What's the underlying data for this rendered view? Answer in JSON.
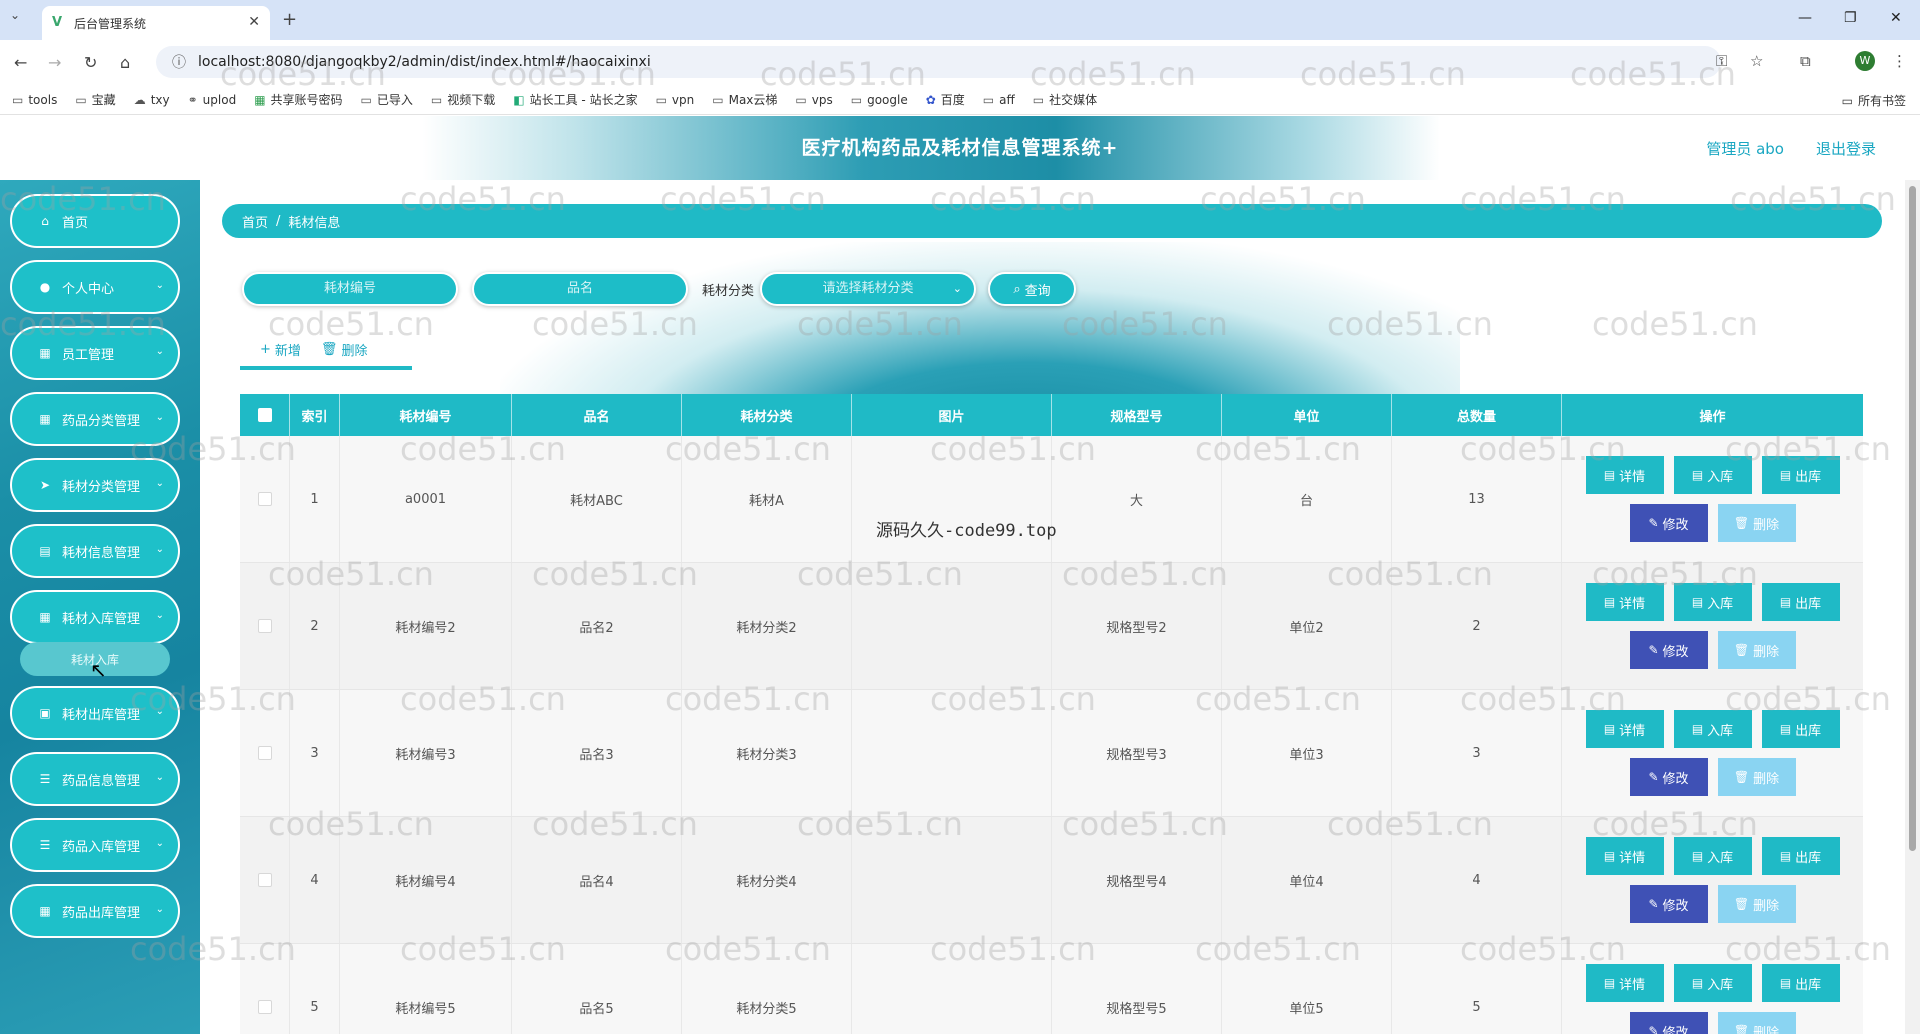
{
  "browser": {
    "tab_title": "后台管理系统",
    "url": "localhost:8080/djangoqkby2/admin/dist/index.html#/haocaixinxi",
    "profile_initial": "W",
    "bookmarks": [
      "tools",
      "宝藏",
      "txy",
      "uplod",
      "共享账号密码",
      "已导入",
      "视频下载",
      "站长工具 - 站长之家",
      "vpn",
      "Max云梯",
      "vps",
      "google",
      "百度",
      "aff",
      "社交媒体"
    ],
    "all_bookmarks": "所有书签"
  },
  "header": {
    "title": "医疗机构药品及耗材信息管理系统+",
    "user": "管理员 abo",
    "logout": "退出登录"
  },
  "sidebar": {
    "items": [
      {
        "label": "首页",
        "icon": "home-icon"
      },
      {
        "label": "个人中心",
        "icon": "user-icon"
      },
      {
        "label": "员工管理",
        "icon": "grid-icon"
      },
      {
        "label": "药品分类管理",
        "icon": "grid-icon"
      },
      {
        "label": "耗材分类管理",
        "icon": "send-icon"
      },
      {
        "label": "耗材信息管理",
        "icon": "table-icon"
      },
      {
        "label": "耗材入库管理",
        "icon": "grid-icon"
      },
      {
        "label": "耗材出库管理",
        "icon": "box-icon"
      },
      {
        "label": "药品信息管理",
        "icon": "list-icon"
      },
      {
        "label": "药品入库管理",
        "icon": "list-icon"
      },
      {
        "label": "药品出库管理",
        "icon": "grid-icon"
      }
    ],
    "sub_item": "耗材入库"
  },
  "breadcrumb": {
    "home": "首页",
    "current": "耗材信息"
  },
  "search": {
    "code_placeholder": "耗材编号",
    "name_placeholder": "品名",
    "category_label": "耗材分类",
    "category_placeholder": "请选择耗材分类",
    "query_button": "查询"
  },
  "toolbar": {
    "add": "新增",
    "delete": "删除"
  },
  "table": {
    "headers": [
      "索引",
      "耗材编号",
      "品名",
      "耗材分类",
      "图片",
      "规格型号",
      "单位",
      "总数量",
      "操作"
    ],
    "rows": [
      {
        "index": "1",
        "code": "a0001",
        "name": "耗材ABC",
        "category": "耗材A",
        "spec": "大",
        "unit": "台",
        "total": "13"
      },
      {
        "index": "2",
        "code": "耗材编号2",
        "name": "品名2",
        "category": "耗材分类2",
        "spec": "规格型号2",
        "unit": "单位2",
        "total": "2"
      },
      {
        "index": "3",
        "code": "耗材编号3",
        "name": "品名3",
        "category": "耗材分类3",
        "spec": "规格型号3",
        "unit": "单位3",
        "total": "3"
      },
      {
        "index": "4",
        "code": "耗材编号4",
        "name": "品名4",
        "category": "耗材分类4",
        "spec": "规格型号4",
        "unit": "单位4",
        "total": "4"
      },
      {
        "index": "5",
        "code": "耗材编号5",
        "name": "品名5",
        "category": "耗材分类5",
        "spec": "规格型号5",
        "unit": "单位5",
        "total": "5"
      }
    ],
    "actions": {
      "detail": "详情",
      "in": "入库",
      "out": "出库",
      "edit": "修改",
      "del": "删除"
    }
  },
  "overlay_text": "源码久久-code99.top",
  "watermark": "code51.cn",
  "colors": {
    "accent": "#1fbac6",
    "indigo": "#3f51b5",
    "light": "#8ad4f2"
  }
}
